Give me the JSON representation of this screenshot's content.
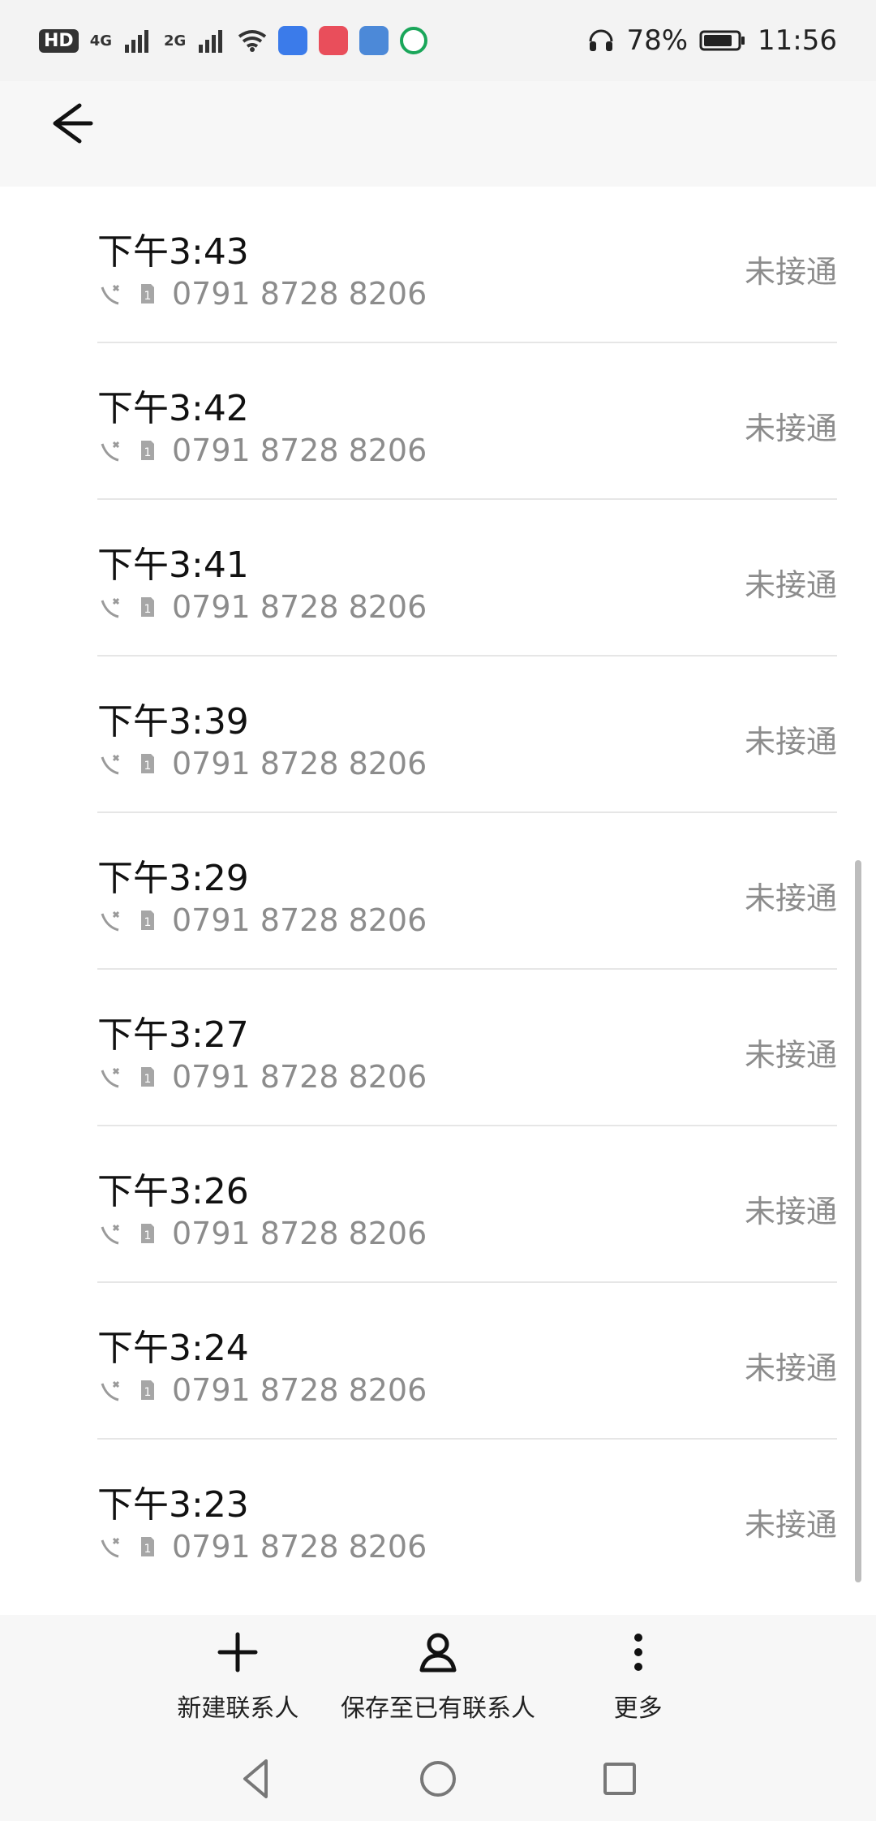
{
  "statusbar": {
    "left_items": [
      "HD",
      "4G",
      "2G"
    ],
    "battery_text": "78%",
    "time": "11:56"
  },
  "calls": [
    {
      "time": "下午3:43",
      "number": "0791 8728 8206",
      "status": "未接通"
    },
    {
      "time": "下午3:42",
      "number": "0791 8728 8206",
      "status": "未接通"
    },
    {
      "time": "下午3:41",
      "number": "0791 8728 8206",
      "status": "未接通"
    },
    {
      "time": "下午3:39",
      "number": "0791 8728 8206",
      "status": "未接通"
    },
    {
      "time": "下午3:29",
      "number": "0791 8728 8206",
      "status": "未接通"
    },
    {
      "time": "下午3:27",
      "number": "0791 8728 8206",
      "status": "未接通"
    },
    {
      "time": "下午3:26",
      "number": "0791 8728 8206",
      "status": "未接通"
    },
    {
      "time": "下午3:24",
      "number": "0791 8728 8206",
      "status": "未接通"
    },
    {
      "time": "下午3:23",
      "number": "0791 8728 8206",
      "status": "未接通"
    }
  ],
  "actions": {
    "new_contact": "新建联系人",
    "save_existing": "保存至已有联系人",
    "more": "更多"
  },
  "icons": {
    "back": "arrow-left-icon",
    "missed_call": "missed-call-icon",
    "sim1": "sim-1-icon",
    "plus": "plus-icon",
    "person": "person-icon",
    "more": "more-vertical-icon",
    "nav_back": "triangle-back-icon",
    "nav_home": "circle-home-icon",
    "nav_recent": "square-recent-icon"
  },
  "colors": {
    "muted": "#8c8c8c",
    "text": "#111111",
    "divider": "#e6e6e6",
    "bar_bg": "#f7f7f7"
  }
}
